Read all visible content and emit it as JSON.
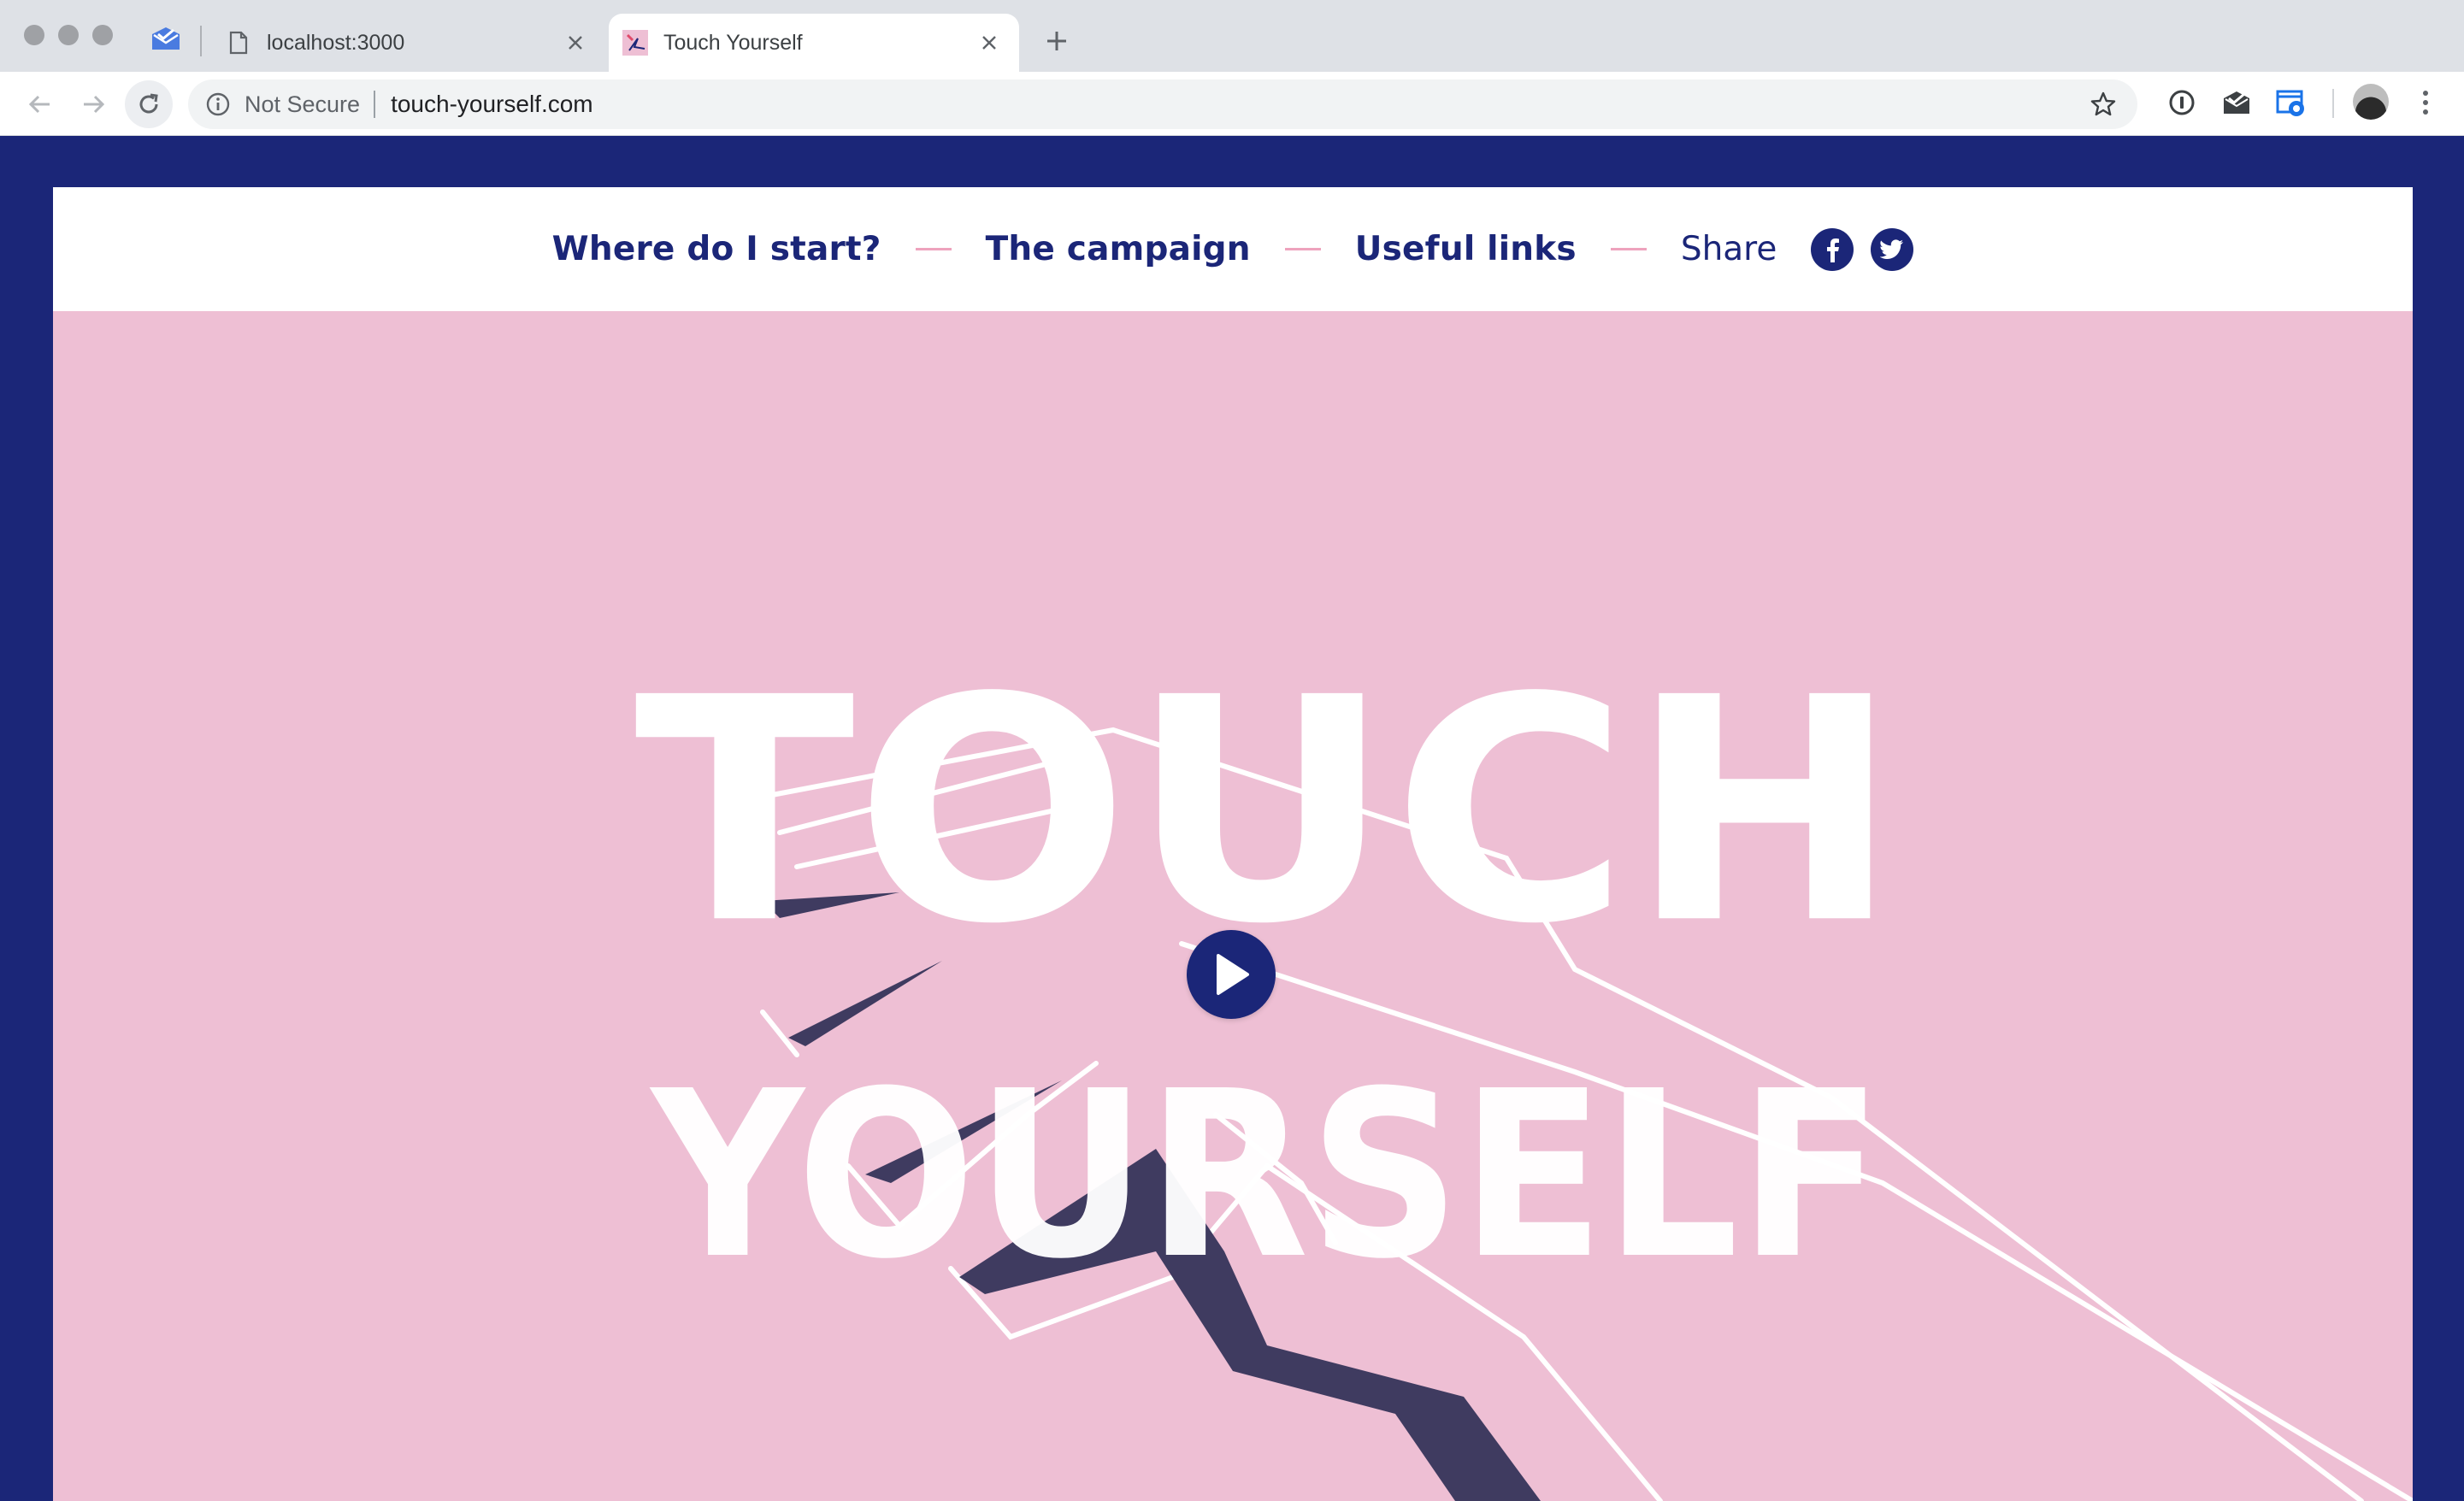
{
  "browser": {
    "tabs": [
      {
        "title": "localhost:3000",
        "icon": "document-icon"
      },
      {
        "title": "Touch Yourself",
        "icon": "site-favicon",
        "active": true
      }
    ],
    "address_bar": {
      "security_label": "Not Secure",
      "url": "touch-yourself.com"
    }
  },
  "site": {
    "nav": {
      "links": [
        "Where do I start?",
        "The campaign",
        "Useful links"
      ],
      "share_label": "Share"
    },
    "hero": {
      "title_line_1": "TOUCH",
      "title_line_2": "YOURSELF"
    }
  },
  "colors": {
    "brand_navy": "#1b2678",
    "hero_pink": "#eebfd4",
    "dash_pink": "#eea3bd"
  }
}
